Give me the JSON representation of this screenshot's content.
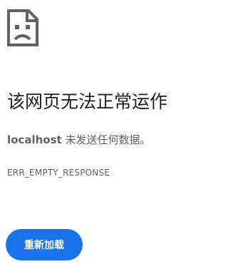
{
  "error_page": {
    "icon": "sad-document-icon",
    "headline": "该网页无法正常运作",
    "host": "localhost",
    "summary_text": " 未发送任何数据。",
    "error_code": "ERR_EMPTY_RESPONSE",
    "reload_label": "重新加载",
    "colors": {
      "button": "#1a73e8",
      "icon": "#5f6368",
      "headline": "#202124",
      "secondary_text": "#5f6368"
    }
  }
}
